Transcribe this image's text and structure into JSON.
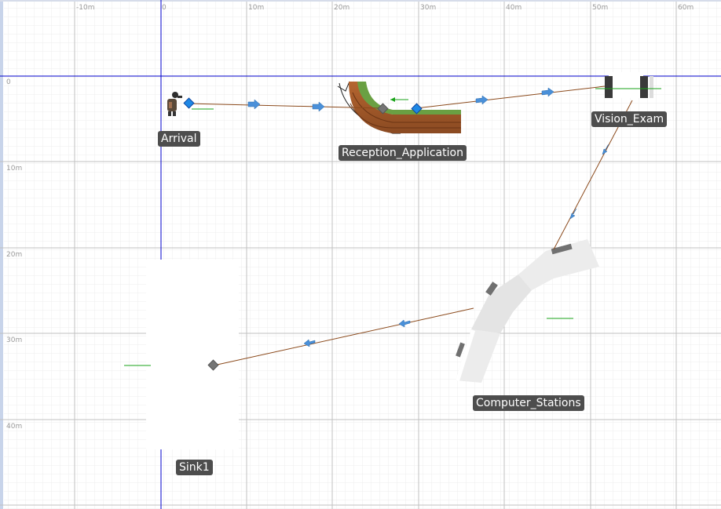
{
  "ruler": {
    "x_ticks": [
      "-10m",
      "0",
      "10m",
      "20m",
      "30m",
      "40m",
      "50m",
      "60m"
    ],
    "y_ticks": [
      "0",
      "10m",
      "20m",
      "30m",
      "40m"
    ]
  },
  "blocks": {
    "arrival": {
      "label": "Arrival"
    },
    "reception": {
      "label": "Reception_Application"
    },
    "vision": {
      "label": "Vision_Exam"
    },
    "computers": {
      "label": "Computer_Stations"
    },
    "sink": {
      "label": "Sink1"
    }
  },
  "colors": {
    "path": "#8b4a1c",
    "arrow": "#4a90d9",
    "port_in": "#1e88e5",
    "port_out": "#757575",
    "axis": "#0000cc",
    "grid_major": "#c0c0c0",
    "grid_minor": "#ececec"
  },
  "icons": [
    "arrival-person-icon",
    "flow-arrow-icon",
    "port-diamond-icon"
  ]
}
